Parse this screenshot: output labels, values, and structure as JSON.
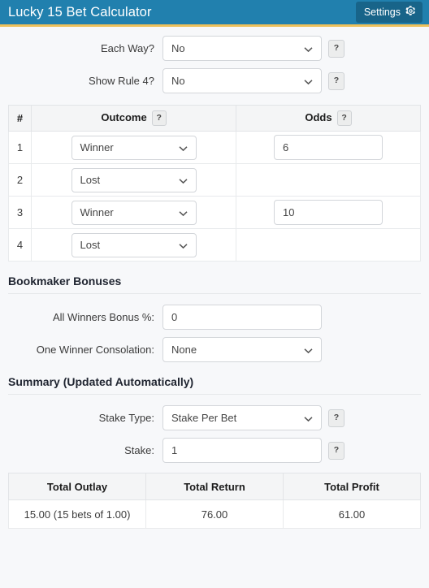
{
  "header": {
    "title": "Lucky 15 Bet Calculator",
    "settings_label": "Settings",
    "settings_icon": "gear-icon",
    "bg_color": "#2180ae",
    "accent_color": "#eec15b",
    "button_color": "#186489"
  },
  "options": {
    "each_way": {
      "label": "Each Way?",
      "value": "No",
      "help": "?"
    },
    "show_rule4": {
      "label": "Show Rule 4?",
      "value": "No",
      "help": "?"
    }
  },
  "bets_table": {
    "columns": [
      "#",
      "Outcome",
      "Odds"
    ],
    "outcome_help": "?",
    "odds_help": "?",
    "rows": [
      {
        "num": "1",
        "outcome": "Winner",
        "odds": "6"
      },
      {
        "num": "2",
        "outcome": "Lost",
        "odds": ""
      },
      {
        "num": "3",
        "outcome": "Winner",
        "odds": "10"
      },
      {
        "num": "4",
        "outcome": "Lost",
        "odds": ""
      }
    ]
  },
  "bonuses": {
    "heading": "Bookmaker Bonuses",
    "all_winners": {
      "label": "All Winners Bonus %:",
      "value": "0"
    },
    "one_winner": {
      "label": "One Winner Consolation:",
      "value": "None"
    }
  },
  "summary": {
    "heading": "Summary (Updated Automatically)",
    "stake_type": {
      "label": "Stake Type:",
      "value": "Stake Per Bet",
      "help": "?"
    },
    "stake": {
      "label": "Stake:",
      "value": "1",
      "help": "?"
    },
    "results": {
      "columns": [
        "Total Outlay",
        "Total Return",
        "Total Profit"
      ],
      "values": [
        "15.00 (15 bets of 1.00)",
        "76.00",
        "61.00"
      ]
    }
  }
}
